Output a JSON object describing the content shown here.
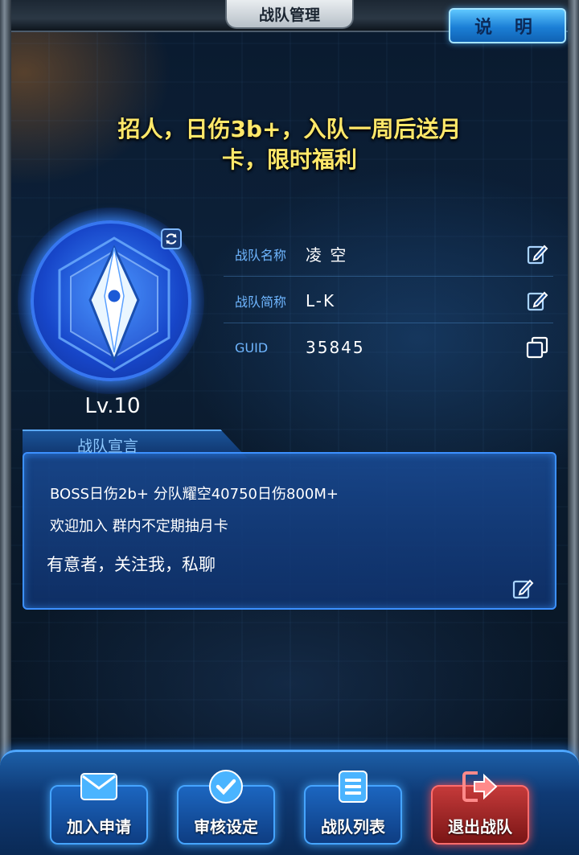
{
  "header": {
    "title": "战队管理",
    "help_label": "说 明"
  },
  "headline": {
    "line1": "招人，日伤3b+，入队一周后送月",
    "line2": "卡，限时福利"
  },
  "team": {
    "level": "Lv.10",
    "fields": [
      {
        "label": "战队名称",
        "value": "凌 空",
        "action_icon": "edit-icon"
      },
      {
        "label": "战队简称",
        "value": "L-K",
        "action_icon": "edit-icon"
      },
      {
        "label": "GUID",
        "value": "35845",
        "action_icon": "copy-icon"
      }
    ]
  },
  "declaration": {
    "title": "战队宣言",
    "lines": [
      "BOSS日伤2b+  分队耀空40750日伤800M+",
      "欢迎加入  群内不定期抽月卡",
      "有意者，关注我，私聊"
    ]
  },
  "actions": [
    {
      "label": "加入申请",
      "icon": "mail-icon"
    },
    {
      "label": "审核设定",
      "icon": "check-circle-icon"
    },
    {
      "label": "战队列表",
      "icon": "list-icon"
    },
    {
      "label": "退出战队",
      "icon": "exit-icon"
    }
  ],
  "colors": {
    "headline": "#ffe86a",
    "field_label": "#6fb6ff",
    "panel_border": "#3c90ff",
    "exit_button": "#c53a3a"
  }
}
